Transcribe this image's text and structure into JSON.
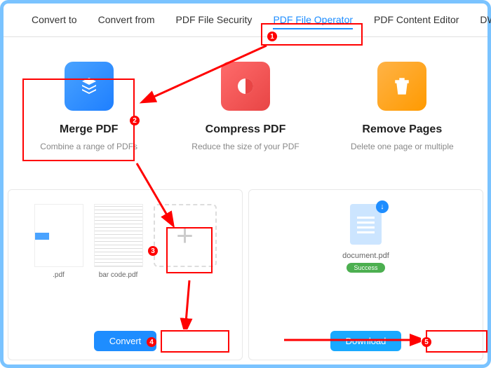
{
  "tabs": [
    "Convert to",
    "Convert from",
    "PDF File Security",
    "PDF File Operator",
    "PDF Content Editor",
    "DWG"
  ],
  "activeTabIndex": 3,
  "operations": [
    {
      "title": "Merge PDF",
      "desc": "Combine a range of PDFs"
    },
    {
      "title": "Compress PDF",
      "desc": "Reduce the size of your PDF"
    },
    {
      "title": "Remove Pages",
      "desc": "Delete one page or multiple"
    }
  ],
  "leftPanel": {
    "files": [
      ".pdf",
      "bar code.pdf"
    ],
    "button": "Convert",
    "addTooltip": "+"
  },
  "rightPanel": {
    "filename": "document.pdf",
    "status": "Success",
    "button": "Download",
    "dlArrow": "↓"
  },
  "markers": [
    "1",
    "2",
    "3",
    "4",
    "5"
  ]
}
